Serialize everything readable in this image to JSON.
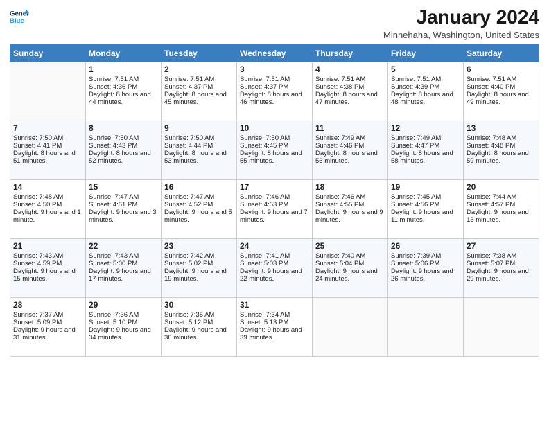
{
  "header": {
    "logo_line1": "General",
    "logo_line2": "Blue",
    "month_title": "January 2024",
    "location": "Minnehaha, Washington, United States"
  },
  "weekdays": [
    "Sunday",
    "Monday",
    "Tuesday",
    "Wednesday",
    "Thursday",
    "Friday",
    "Saturday"
  ],
  "weeks": [
    [
      {
        "num": "",
        "sunrise": "",
        "sunset": "",
        "daylight": ""
      },
      {
        "num": "1",
        "sunrise": "Sunrise: 7:51 AM",
        "sunset": "Sunset: 4:36 PM",
        "daylight": "Daylight: 8 hours and 44 minutes."
      },
      {
        "num": "2",
        "sunrise": "Sunrise: 7:51 AM",
        "sunset": "Sunset: 4:37 PM",
        "daylight": "Daylight: 8 hours and 45 minutes."
      },
      {
        "num": "3",
        "sunrise": "Sunrise: 7:51 AM",
        "sunset": "Sunset: 4:37 PM",
        "daylight": "Daylight: 8 hours and 46 minutes."
      },
      {
        "num": "4",
        "sunrise": "Sunrise: 7:51 AM",
        "sunset": "Sunset: 4:38 PM",
        "daylight": "Daylight: 8 hours and 47 minutes."
      },
      {
        "num": "5",
        "sunrise": "Sunrise: 7:51 AM",
        "sunset": "Sunset: 4:39 PM",
        "daylight": "Daylight: 8 hours and 48 minutes."
      },
      {
        "num": "6",
        "sunrise": "Sunrise: 7:51 AM",
        "sunset": "Sunset: 4:40 PM",
        "daylight": "Daylight: 8 hours and 49 minutes."
      }
    ],
    [
      {
        "num": "7",
        "sunrise": "Sunrise: 7:50 AM",
        "sunset": "Sunset: 4:41 PM",
        "daylight": "Daylight: 8 hours and 51 minutes."
      },
      {
        "num": "8",
        "sunrise": "Sunrise: 7:50 AM",
        "sunset": "Sunset: 4:43 PM",
        "daylight": "Daylight: 8 hours and 52 minutes."
      },
      {
        "num": "9",
        "sunrise": "Sunrise: 7:50 AM",
        "sunset": "Sunset: 4:44 PM",
        "daylight": "Daylight: 8 hours and 53 minutes."
      },
      {
        "num": "10",
        "sunrise": "Sunrise: 7:50 AM",
        "sunset": "Sunset: 4:45 PM",
        "daylight": "Daylight: 8 hours and 55 minutes."
      },
      {
        "num": "11",
        "sunrise": "Sunrise: 7:49 AM",
        "sunset": "Sunset: 4:46 PM",
        "daylight": "Daylight: 8 hours and 56 minutes."
      },
      {
        "num": "12",
        "sunrise": "Sunrise: 7:49 AM",
        "sunset": "Sunset: 4:47 PM",
        "daylight": "Daylight: 8 hours and 58 minutes."
      },
      {
        "num": "13",
        "sunrise": "Sunrise: 7:48 AM",
        "sunset": "Sunset: 4:48 PM",
        "daylight": "Daylight: 8 hours and 59 minutes."
      }
    ],
    [
      {
        "num": "14",
        "sunrise": "Sunrise: 7:48 AM",
        "sunset": "Sunset: 4:50 PM",
        "daylight": "Daylight: 9 hours and 1 minute."
      },
      {
        "num": "15",
        "sunrise": "Sunrise: 7:47 AM",
        "sunset": "Sunset: 4:51 PM",
        "daylight": "Daylight: 9 hours and 3 minutes."
      },
      {
        "num": "16",
        "sunrise": "Sunrise: 7:47 AM",
        "sunset": "Sunset: 4:52 PM",
        "daylight": "Daylight: 9 hours and 5 minutes."
      },
      {
        "num": "17",
        "sunrise": "Sunrise: 7:46 AM",
        "sunset": "Sunset: 4:53 PM",
        "daylight": "Daylight: 9 hours and 7 minutes."
      },
      {
        "num": "18",
        "sunrise": "Sunrise: 7:46 AM",
        "sunset": "Sunset: 4:55 PM",
        "daylight": "Daylight: 9 hours and 9 minutes."
      },
      {
        "num": "19",
        "sunrise": "Sunrise: 7:45 AM",
        "sunset": "Sunset: 4:56 PM",
        "daylight": "Daylight: 9 hours and 11 minutes."
      },
      {
        "num": "20",
        "sunrise": "Sunrise: 7:44 AM",
        "sunset": "Sunset: 4:57 PM",
        "daylight": "Daylight: 9 hours and 13 minutes."
      }
    ],
    [
      {
        "num": "21",
        "sunrise": "Sunrise: 7:43 AM",
        "sunset": "Sunset: 4:59 PM",
        "daylight": "Daylight: 9 hours and 15 minutes."
      },
      {
        "num": "22",
        "sunrise": "Sunrise: 7:43 AM",
        "sunset": "Sunset: 5:00 PM",
        "daylight": "Daylight: 9 hours and 17 minutes."
      },
      {
        "num": "23",
        "sunrise": "Sunrise: 7:42 AM",
        "sunset": "Sunset: 5:02 PM",
        "daylight": "Daylight: 9 hours and 19 minutes."
      },
      {
        "num": "24",
        "sunrise": "Sunrise: 7:41 AM",
        "sunset": "Sunset: 5:03 PM",
        "daylight": "Daylight: 9 hours and 22 minutes."
      },
      {
        "num": "25",
        "sunrise": "Sunrise: 7:40 AM",
        "sunset": "Sunset: 5:04 PM",
        "daylight": "Daylight: 9 hours and 24 minutes."
      },
      {
        "num": "26",
        "sunrise": "Sunrise: 7:39 AM",
        "sunset": "Sunset: 5:06 PM",
        "daylight": "Daylight: 9 hours and 26 minutes."
      },
      {
        "num": "27",
        "sunrise": "Sunrise: 7:38 AM",
        "sunset": "Sunset: 5:07 PM",
        "daylight": "Daylight: 9 hours and 29 minutes."
      }
    ],
    [
      {
        "num": "28",
        "sunrise": "Sunrise: 7:37 AM",
        "sunset": "Sunset: 5:09 PM",
        "daylight": "Daylight: 9 hours and 31 minutes."
      },
      {
        "num": "29",
        "sunrise": "Sunrise: 7:36 AM",
        "sunset": "Sunset: 5:10 PM",
        "daylight": "Daylight: 9 hours and 34 minutes."
      },
      {
        "num": "30",
        "sunrise": "Sunrise: 7:35 AM",
        "sunset": "Sunset: 5:12 PM",
        "daylight": "Daylight: 9 hours and 36 minutes."
      },
      {
        "num": "31",
        "sunrise": "Sunrise: 7:34 AM",
        "sunset": "Sunset: 5:13 PM",
        "daylight": "Daylight: 9 hours and 39 minutes."
      },
      {
        "num": "",
        "sunrise": "",
        "sunset": "",
        "daylight": ""
      },
      {
        "num": "",
        "sunrise": "",
        "sunset": "",
        "daylight": ""
      },
      {
        "num": "",
        "sunrise": "",
        "sunset": "",
        "daylight": ""
      }
    ]
  ]
}
